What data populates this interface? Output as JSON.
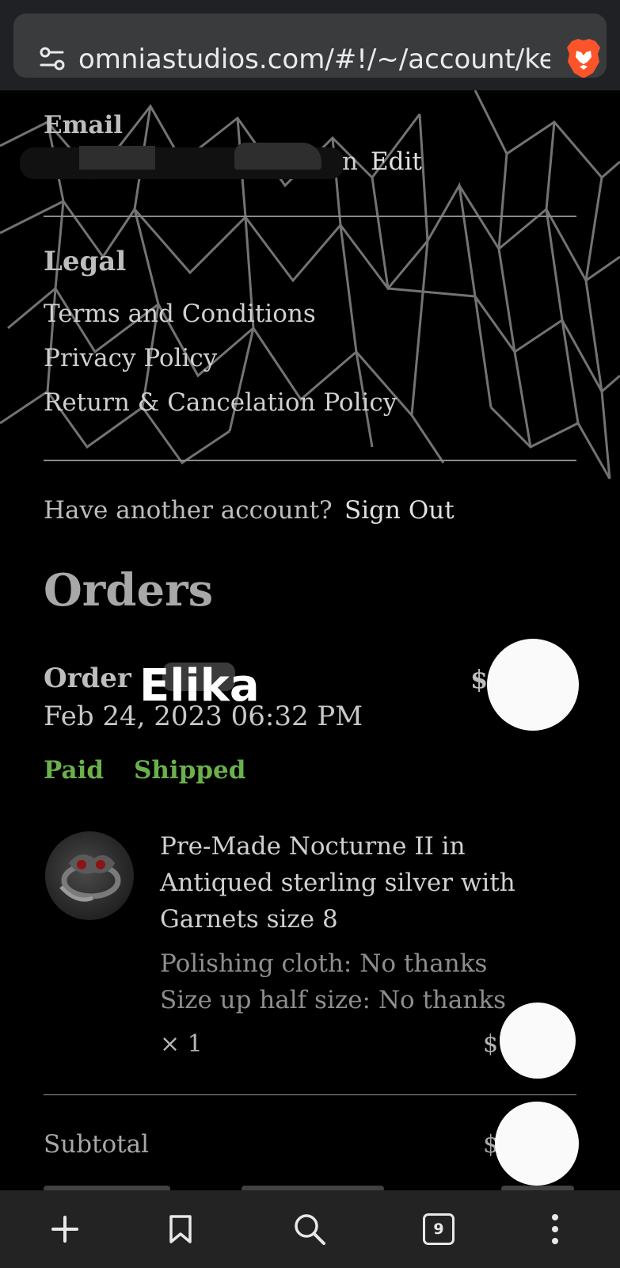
{
  "browser": {
    "url": "omniastudios.com/#!/~/account/ke",
    "tab_count": "9"
  },
  "account": {
    "email_label": "Email",
    "email_visible_tail": "n",
    "edit_label": "Edit",
    "legal_label": "Legal",
    "legal_links": [
      "Terms and Conditions",
      "Privacy Policy",
      "Return & Cancelation Policy"
    ],
    "another_account": "Have another account?",
    "sign_out": "Sign Out"
  },
  "orders": {
    "heading": "Orders",
    "order_label": "Order",
    "order_overlay": "Elika",
    "order_total_prefix": "$",
    "order_date": "Feb 24, 2023 06:32 PM",
    "statuses": [
      "Paid",
      "Shipped"
    ],
    "item": {
      "name_lines": [
        "Pre-Made Nocturne II in",
        "Antiqued sterling silver with",
        "Garnets size 8"
      ],
      "options": [
        "Polishing cloth: No thanks",
        "Size up half size: No thanks"
      ],
      "quantity": "× 1",
      "price_prefix": "$"
    },
    "subtotal_label": "Subtotal",
    "subtotal_prefix": "$"
  },
  "colors": {
    "status_green": "#6ab04c",
    "topbar": "#202124",
    "urlbox": "#3a3b3d",
    "brave_orange": "#fb542b"
  }
}
